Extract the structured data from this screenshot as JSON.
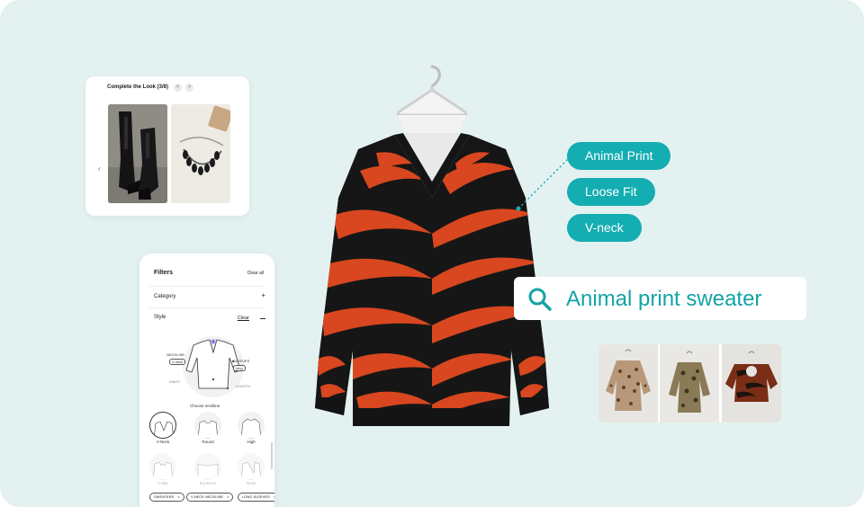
{
  "complete_look": {
    "title": "Complete the Look (3/8)",
    "prev_label": "<",
    "next_label": ">",
    "carousel_prev": "‹",
    "items": [
      "boots",
      "necklace"
    ]
  },
  "filters": {
    "title": "Filters",
    "clear_all": "Clear all",
    "category_label": "Category",
    "category_toggle": "+",
    "style_label": "Style",
    "style_clear": "Clear",
    "diagram": {
      "neckline": "NECKLINE",
      "neckline_value": "V-neck",
      "sleeves": "SLEEVES",
      "sleeves_value": "long",
      "waist": "WAIST",
      "length": "LENGTH",
      "hint": "Choose neckline"
    },
    "necklines": [
      {
        "label": "V-Neck",
        "selected": true
      },
      {
        "label": "Round",
        "selected": false
      },
      {
        "label": "High",
        "selected": false
      },
      {
        "label": "Collar",
        "selected": false
      },
      {
        "label": "Boatneck",
        "selected": false
      },
      {
        "label": "Wrap",
        "selected": false
      }
    ],
    "chips": [
      "SWEATERS",
      "V-NECK NECKLINE",
      "LONG SLEEVES"
    ],
    "chip_remove": "×"
  },
  "tags": [
    "Animal Print",
    "Loose Fit",
    "V-neck"
  ],
  "search": {
    "query": "Animal print sweater",
    "icon": "search-icon"
  },
  "colors": {
    "background": "#e3f2f1",
    "accent": "#14adb1",
    "sweater_orange": "#d8471f",
    "sweater_black": "#161616"
  },
  "results": [
    "leopard-blouse",
    "snake-print-top",
    "tiger-print-top"
  ]
}
